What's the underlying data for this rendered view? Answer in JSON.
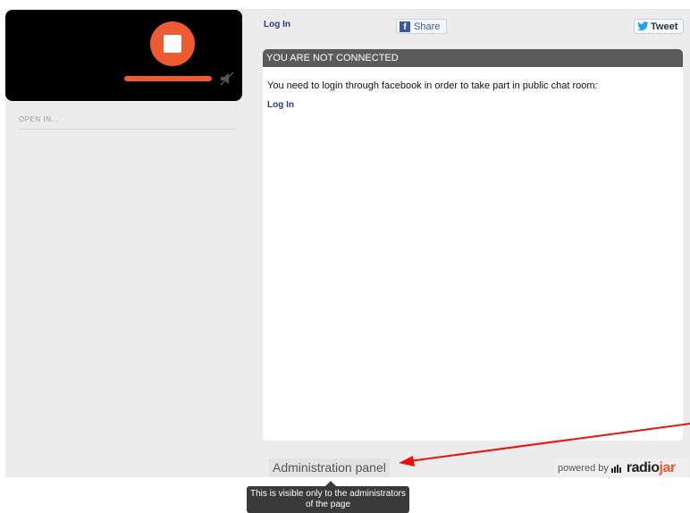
{
  "player": {
    "stop_icon": "stop-icon",
    "volume_level": 1.0,
    "mute_icon": "speaker-muted-icon",
    "accent_color": "#f05a30",
    "open_in_label": "OPEN IN..."
  },
  "topbar": {
    "login_label": "Log In",
    "share_label": "Share",
    "tweet_label": "Tweet"
  },
  "chat": {
    "header": "YOU ARE NOT CONNECTED",
    "message": "You need to login through facebook in order to take part in public chat room:",
    "login_label": "Log In"
  },
  "footer": {
    "admin_panel_label": "Administration panel",
    "powered_label": "powered by",
    "brand_part1": "radio",
    "brand_part2": "jar",
    "tooltip_text": "This is visible only to the administrators of the page"
  },
  "annotation": {
    "arrow_color": "#e8130c"
  }
}
